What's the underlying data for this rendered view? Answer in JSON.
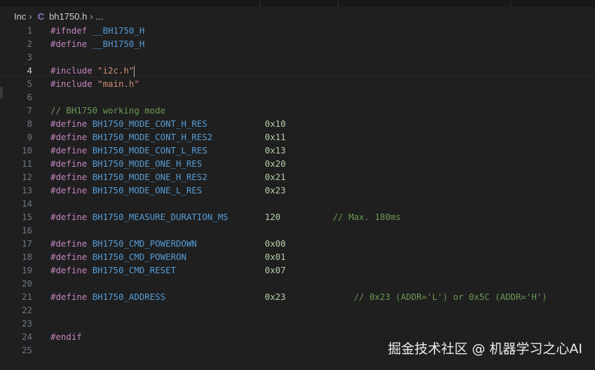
{
  "breadcrumb": {
    "folder": "Inc",
    "file_icon": "C",
    "file": "bh1750.h",
    "more": "..."
  },
  "editor": {
    "current_line": 4,
    "lines": [
      [
        [
          "#ifndef ",
          "kw"
        ],
        [
          "__BH1750_H",
          "mac"
        ]
      ],
      [
        [
          "#define ",
          "kw"
        ],
        [
          "__BH1750_H",
          "mac"
        ]
      ],
      [],
      [
        [
          "#include ",
          "kw"
        ],
        [
          "\"i2c.h\"",
          "str"
        ]
      ],
      [
        [
          "#include ",
          "kw"
        ],
        [
          "\"main.h\"",
          "str"
        ]
      ],
      [],
      [
        [
          "// BH1750 working mode",
          "cmt"
        ]
      ],
      [
        [
          "#define ",
          "kw"
        ],
        [
          "BH1750_MODE_CONT_H_RES           ",
          "mac"
        ],
        [
          "0x10",
          "num"
        ]
      ],
      [
        [
          "#define ",
          "kw"
        ],
        [
          "BH1750_MODE_CONT_H_RES2          ",
          "mac"
        ],
        [
          "0x11",
          "num"
        ]
      ],
      [
        [
          "#define ",
          "kw"
        ],
        [
          "BH1750_MODE_CONT_L_RES           ",
          "mac"
        ],
        [
          "0x13",
          "num"
        ]
      ],
      [
        [
          "#define ",
          "kw"
        ],
        [
          "BH1750_MODE_ONE_H_RES            ",
          "mac"
        ],
        [
          "0x20",
          "num"
        ]
      ],
      [
        [
          "#define ",
          "kw"
        ],
        [
          "BH1750_MODE_ONE_H_RES2           ",
          "mac"
        ],
        [
          "0x21",
          "num"
        ]
      ],
      [
        [
          "#define ",
          "kw"
        ],
        [
          "BH1750_MODE_ONE_L_RES            ",
          "mac"
        ],
        [
          "0x23",
          "num"
        ]
      ],
      [],
      [
        [
          "#define ",
          "kw"
        ],
        [
          "BH1750_MEASURE_DURATION_MS       ",
          "mac"
        ],
        [
          "120",
          "num"
        ],
        [
          "          ",
          "pl"
        ],
        [
          "// Max. 180ms",
          "cmt"
        ]
      ],
      [],
      [
        [
          "#define ",
          "kw"
        ],
        [
          "BH1750_CMD_POWERDOWN             ",
          "mac"
        ],
        [
          "0x00",
          "num"
        ]
      ],
      [
        [
          "#define ",
          "kw"
        ],
        [
          "BH1750_CMD_POWERON               ",
          "mac"
        ],
        [
          "0x01",
          "num"
        ]
      ],
      [
        [
          "#define ",
          "kw"
        ],
        [
          "BH1750_CMD_RESET                 ",
          "mac"
        ],
        [
          "0x07",
          "num"
        ]
      ],
      [],
      [
        [
          "#define ",
          "kw"
        ],
        [
          "BH1750_ADDRESS                   ",
          "mac"
        ],
        [
          "0x23",
          "num"
        ],
        [
          "             ",
          "pl"
        ],
        [
          "// 0x23 (ADDR='L') or 0x5C (ADDR='H')",
          "cmt"
        ]
      ],
      [],
      [],
      [
        [
          "#endif",
          "kw"
        ]
      ],
      []
    ]
  },
  "watermark": "掘金技术社区 @ 机器学习之心AI"
}
